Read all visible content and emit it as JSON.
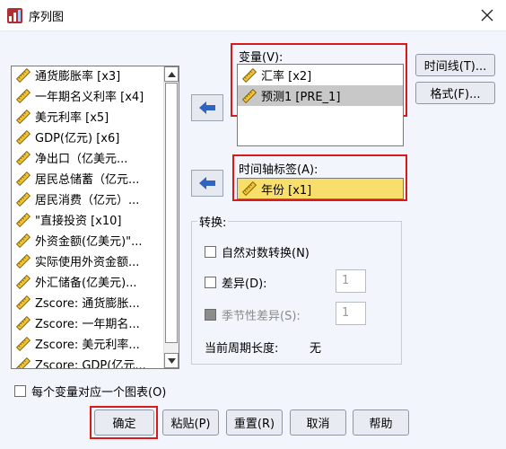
{
  "window": {
    "title": "序列图"
  },
  "source": {
    "items": [
      {
        "label": "通货膨胀率 [x3]"
      },
      {
        "label": "一年期名义利率 [x4]"
      },
      {
        "label": "美元利率 [x5]"
      },
      {
        "label": "GDP(亿元) [x6]"
      },
      {
        "label": "净出口（亿美元..."
      },
      {
        "label": "居民总储蓄（亿元..."
      },
      {
        "label": "居民消费（亿元）..."
      },
      {
        "label": "\"直接投资 [x10]"
      },
      {
        "label": "外资金额(亿美元)\"..."
      },
      {
        "label": "实际使用外资金额..."
      },
      {
        "label": "外汇储备(亿美元)..."
      },
      {
        "label": "Zscore: 通货膨胀..."
      },
      {
        "label": "Zscore: 一年期名..."
      },
      {
        "label": "Zscore: 美元利率..."
      },
      {
        "label": "Zscore: GDP(亿元..."
      }
    ]
  },
  "variables": {
    "label": "变量(V):",
    "items": [
      {
        "label": "汇率 [x2]"
      },
      {
        "label": "预测1 [PRE_1]"
      }
    ]
  },
  "time_axis": {
    "label": "时间轴标签(A):",
    "value": "年份 [x1]"
  },
  "transform": {
    "group_label": "转换:",
    "natural_log": "自然对数转换(N)",
    "difference": "差异(D):",
    "difference_value": "1",
    "seasonal_difference": "季节性差异(S):",
    "seasonal_value": "1",
    "period_label": "当前周期长度:",
    "period_value": "无"
  },
  "one_chart_per_variable": "每个变量对应一个图表(O)",
  "side_buttons": {
    "time_lines": "时间线(T)...",
    "format": "格式(F)..."
  },
  "buttons": {
    "ok": "确定",
    "paste": "粘贴(P)",
    "reset": "重置(R)",
    "cancel": "取消",
    "help": "帮助"
  },
  "colors": {
    "selection_gray": "#c8c8c8",
    "time_axis_highlight": "#f8df6b",
    "red_annotation": "#d91a1a",
    "arrow_blue": "#2f64c2"
  }
}
